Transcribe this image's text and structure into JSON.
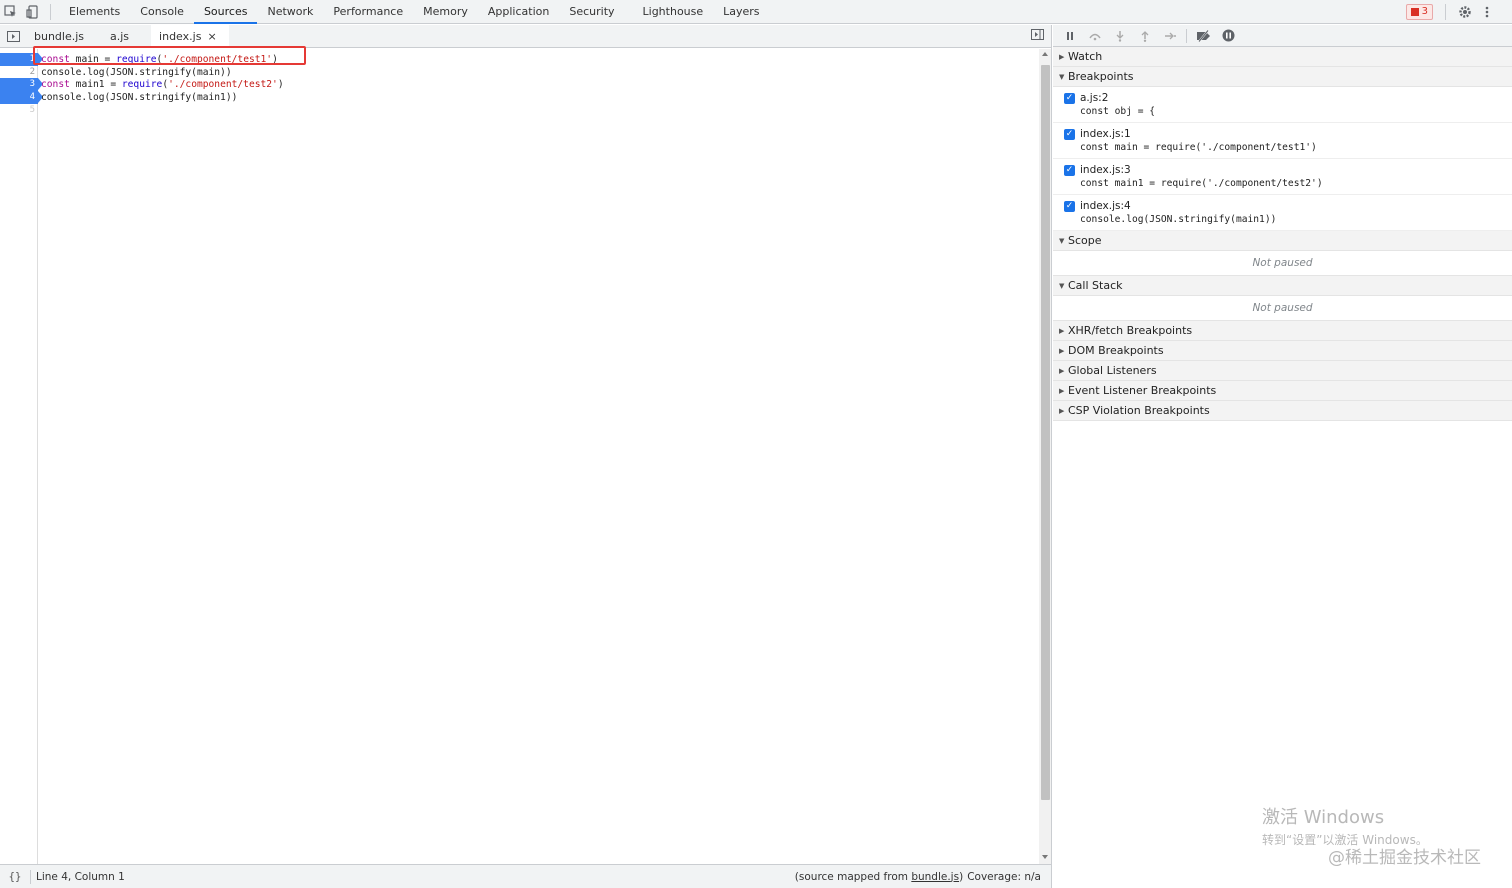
{
  "panel_tabs": [
    "Elements",
    "Console",
    "Sources",
    "Network",
    "Performance",
    "Memory",
    "Application",
    "Security",
    "Lighthouse",
    "Layers"
  ],
  "active_panel_tab": "Sources",
  "error_count": "3",
  "file_tabs": [
    {
      "label": "bundle.js",
      "closable": false
    },
    {
      "label": "a.js",
      "closable": false
    },
    {
      "label": "index.js",
      "closable": true
    }
  ],
  "active_file_tab": "index.js",
  "close_glyph": "×",
  "code": {
    "line_numbers": [
      "1",
      "2",
      "3",
      "4",
      "5"
    ],
    "breakpoint_lines": [
      1,
      3,
      4
    ]
  },
  "status": {
    "format_glyph": "{}",
    "cursor": "Line 4, Column 1",
    "mapped_prefix": "(source mapped from ",
    "mapped_link": "bundle.js",
    "mapped_suffix": ")",
    "coverage": "Coverage: n/a"
  },
  "debugger": {
    "watch": "Watch",
    "breakpoints_title": "Breakpoints",
    "breakpoints": [
      {
        "location": "a.js:2",
        "source": "const obj = {",
        "checked": true
      },
      {
        "location": "index.js:1",
        "source": "const main = require('./component/test1')",
        "checked": true
      },
      {
        "location": "index.js:3",
        "source": "const main1 = require('./component/test2')",
        "checked": true
      },
      {
        "location": "index.js:4",
        "source": "console.log(JSON.stringify(main1))",
        "checked": true
      }
    ],
    "scope_title": "Scope",
    "scope_state": "Not paused",
    "callstack_title": "Call Stack",
    "callstack_state": "Not paused",
    "collapsed_sections": [
      "XHR/fetch Breakpoints",
      "DOM Breakpoints",
      "Global Listeners",
      "Event Listener Breakpoints",
      "CSP Violation Breakpoints"
    ]
  },
  "watermark": {
    "line1": "激活 Windows",
    "line2": "转到“设置”以激活 Windows。",
    "site": "@稀土掘金技术社区"
  },
  "colors": {
    "accent": "#1a73e8",
    "breakpoint": "#3b82f0",
    "highlight_box": "#e53935"
  }
}
